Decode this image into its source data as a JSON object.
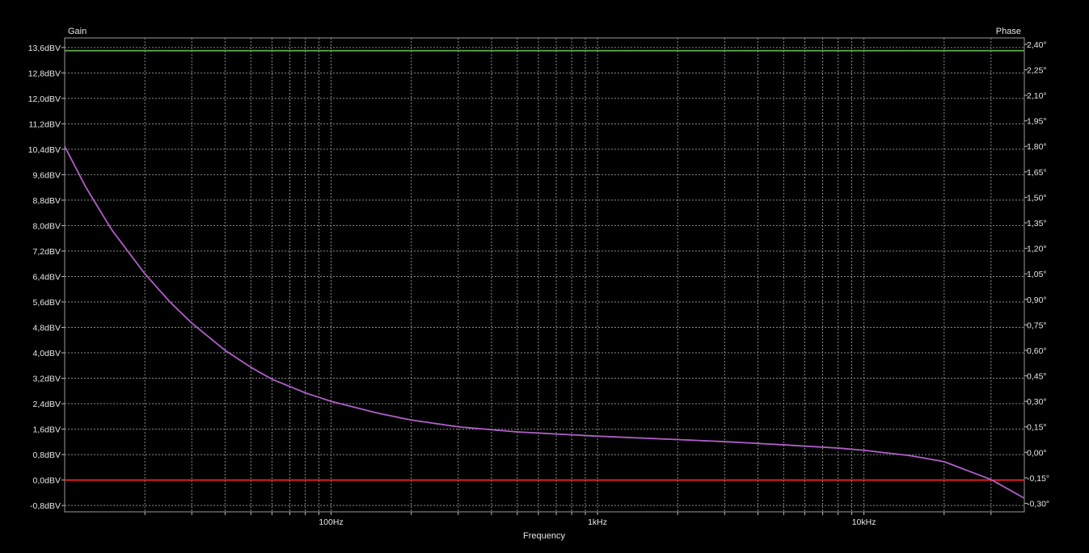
{
  "window": {
    "title": ""
  },
  "chart_data": {
    "type": "line",
    "title": "",
    "xlabel": "Frequency",
    "ylabel_left": "Gain",
    "ylabel_right": "Phase",
    "x_scale": "log",
    "xlim_hz": [
      10,
      40000
    ],
    "x_tick_labels": [
      {
        "value": 100,
        "label": "100Hz"
      },
      {
        "value": 1000,
        "label": "1kHz"
      },
      {
        "value": 10000,
        "label": "10kHz"
      }
    ],
    "ylim_left_db": [
      -1.0,
      13.9
    ],
    "ylim_right_deg": [
      -0.35,
      2.4375
    ],
    "y_left_ticks": [
      {
        "value": 13.6,
        "label": "13,6dBV"
      },
      {
        "value": 12.8,
        "label": "12,8dBV"
      },
      {
        "value": 12.0,
        "label": "12,0dBV"
      },
      {
        "value": 11.2,
        "label": "11,2dBV"
      },
      {
        "value": 10.4,
        "label": "10,4dBV"
      },
      {
        "value": 9.6,
        "label": "9,6dBV"
      },
      {
        "value": 8.8,
        "label": "8,8dBV"
      },
      {
        "value": 8.0,
        "label": "8,0dBV"
      },
      {
        "value": 7.2,
        "label": "7,2dBV"
      },
      {
        "value": 6.4,
        "label": "6,4dBV"
      },
      {
        "value": 5.6,
        "label": "5,6dBV"
      },
      {
        "value": 4.8,
        "label": "4,8dBV"
      },
      {
        "value": 4.0,
        "label": "4,0dBV"
      },
      {
        "value": 3.2,
        "label": "3,2dBV"
      },
      {
        "value": 2.4,
        "label": "2,4dBV"
      },
      {
        "value": 1.6,
        "label": "1,6dBV"
      },
      {
        "value": 0.8,
        "label": "0,8dBV"
      },
      {
        "value": 0.0,
        "label": "0,0dBV"
      },
      {
        "value": -0.8,
        "label": "-0,8dBV"
      }
    ],
    "y_right_ticks": [
      {
        "value": 2.4,
        "label": "2,40°"
      },
      {
        "value": 2.25,
        "label": "2,25°"
      },
      {
        "value": 2.1,
        "label": "2,10°"
      },
      {
        "value": 1.95,
        "label": "1,95°"
      },
      {
        "value": 1.8,
        "label": "1,80°"
      },
      {
        "value": 1.65,
        "label": "1,65°"
      },
      {
        "value": 1.5,
        "label": "1,50°"
      },
      {
        "value": 1.35,
        "label": "1,35°"
      },
      {
        "value": 1.2,
        "label": "1,20°"
      },
      {
        "value": 1.05,
        "label": "1,05°"
      },
      {
        "value": 0.9,
        "label": "0,90°"
      },
      {
        "value": 0.75,
        "label": "0,75°"
      },
      {
        "value": 0.6,
        "label": "0,60°"
      },
      {
        "value": 0.45,
        "label": "0,45°"
      },
      {
        "value": 0.3,
        "label": "0,30°"
      },
      {
        "value": 0.15,
        "label": "0,15°"
      },
      {
        "value": 0.0,
        "label": "0,00°"
      },
      {
        "value": -0.15,
        "label": "-0,15°"
      },
      {
        "value": -0.3,
        "label": "-0,30°"
      }
    ],
    "grid": true,
    "series": [
      {
        "axis": "left",
        "color": "#5fae4a",
        "x_hz": [
          10,
          40000
        ],
        "y": [
          13.5,
          13.5
        ]
      },
      {
        "axis": "left",
        "color": "#ff2020",
        "x_hz": [
          10,
          40000
        ],
        "y": [
          0.0,
          0.0
        ]
      },
      {
        "axis": "right",
        "color": "#b05fc8",
        "x_hz": [
          10,
          12,
          15,
          20,
          25,
          30,
          40,
          50,
          60,
          80,
          100,
          150,
          200,
          300,
          500,
          1000,
          2000,
          3000,
          5000,
          8000,
          10000,
          15000,
          20000,
          30000,
          40000
        ],
        "y": [
          1.8,
          1.56,
          1.31,
          1.05,
          0.88,
          0.76,
          0.6,
          0.5,
          0.43,
          0.35,
          0.3,
          0.23,
          0.19,
          0.15,
          0.12,
          0.095,
          0.075,
          0.063,
          0.044,
          0.025,
          0.012,
          -0.02,
          -0.055,
          -0.16,
          -0.27
        ]
      }
    ]
  }
}
